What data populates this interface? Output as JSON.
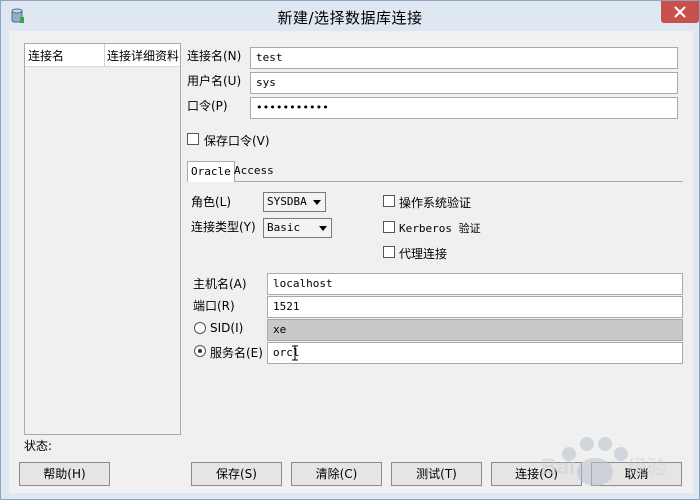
{
  "window": {
    "title": "新建/选择数据库连接"
  },
  "list": {
    "columns": [
      "连接名",
      "连接详细资料"
    ]
  },
  "status_label": "状态:",
  "form": {
    "conn_name": {
      "label": "连接名(N)",
      "value": "test"
    },
    "user_name": {
      "label": "用户名(U)",
      "value": "sys"
    },
    "password": {
      "label": "口令(P)",
      "value": "•••••••••••"
    },
    "save_password": {
      "label": "保存口令(V)",
      "checked": false
    }
  },
  "tabs": [
    {
      "label": "Oracle",
      "active": true
    },
    {
      "label": "Access",
      "active": false
    }
  ],
  "oracle": {
    "role": {
      "label": "角色(L)",
      "value": "SYSDBA"
    },
    "conn_type": {
      "label": "连接类型(Y)",
      "value": "Basic"
    },
    "os_auth": {
      "label": "操作系统验证",
      "checked": false
    },
    "kerberos": {
      "label": "Kerberos 验证",
      "checked": false
    },
    "proxy": {
      "label": "代理连接",
      "checked": false
    },
    "host": {
      "label": "主机名(A)",
      "value": "localhost"
    },
    "port": {
      "label": "端口(R)",
      "value": "1521"
    },
    "sid": {
      "label": "SID(I)",
      "value": "xe",
      "selected": false
    },
    "service": {
      "label": "服务名(E)",
      "value": "orcl",
      "selected": true
    }
  },
  "buttons": {
    "help": "帮助(H)",
    "save": "保存(S)",
    "clear": "清除(C)",
    "test": "测试(T)",
    "connect": "连接(O)",
    "cancel": "取消"
  },
  "watermark": {
    "text": "Baidu 经验"
  }
}
